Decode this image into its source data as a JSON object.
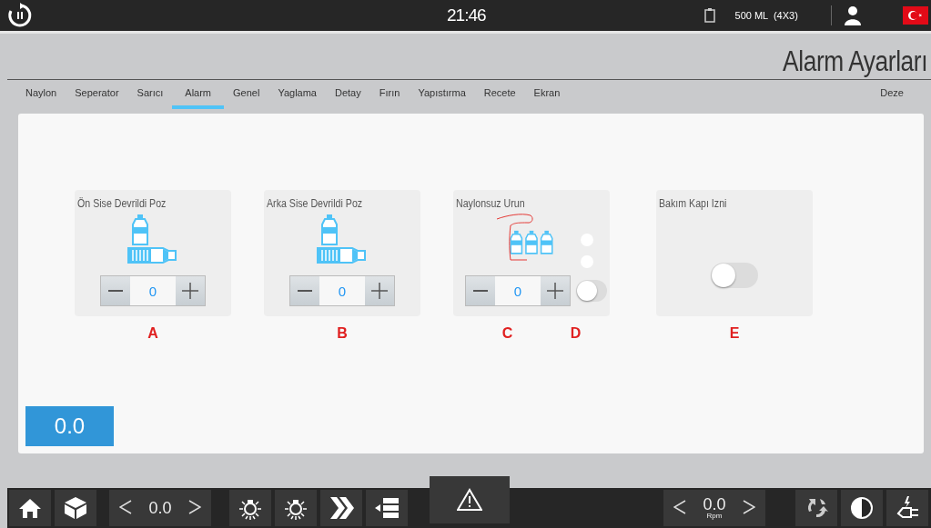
{
  "top_bar": {
    "time": "21:46",
    "recipe": "500 ML  (4X3)"
  },
  "title": "Alarm Ayarları",
  "tabs": [
    {
      "label": "Naylon",
      "selected": false
    },
    {
      "label": "Seperator",
      "selected": false
    },
    {
      "label": "Sarıcı",
      "selected": false
    },
    {
      "label": "Alarm",
      "selected": true
    },
    {
      "label": "Genel",
      "selected": false
    },
    {
      "label": "Yaglama",
      "selected": false
    },
    {
      "label": "Detay",
      "selected": false
    },
    {
      "label": "Fırın",
      "selected": false
    },
    {
      "label": "Yapıstırma",
      "selected": false
    },
    {
      "label": "Recete",
      "selected": false
    },
    {
      "label": "Ekran",
      "selected": false
    },
    {
      "label": "Deze",
      "selected": false
    }
  ],
  "cards": [
    {
      "kind": "counter",
      "title": "Ön Sise  Devrildi Poz",
      "value": "0",
      "markers": [
        "A"
      ]
    },
    {
      "kind": "counter",
      "title": "Arka Sise  Devrildi Poz",
      "value": "0",
      "markers": [
        "B"
      ]
    },
    {
      "kind": "counter_toggle",
      "title": "Naylonsuz Urun",
      "value": "0",
      "on": false,
      "markers": [
        "C",
        "D"
      ]
    },
    {
      "kind": "toggle",
      "title": "Bakım Kapı Izni",
      "on": false,
      "markers": [
        "E"
      ]
    }
  ],
  "value_box": "0.0",
  "bottom_bar": {
    "speed": "0.0",
    "right_value": "0.0",
    "right_unit": "Rpm"
  }
}
